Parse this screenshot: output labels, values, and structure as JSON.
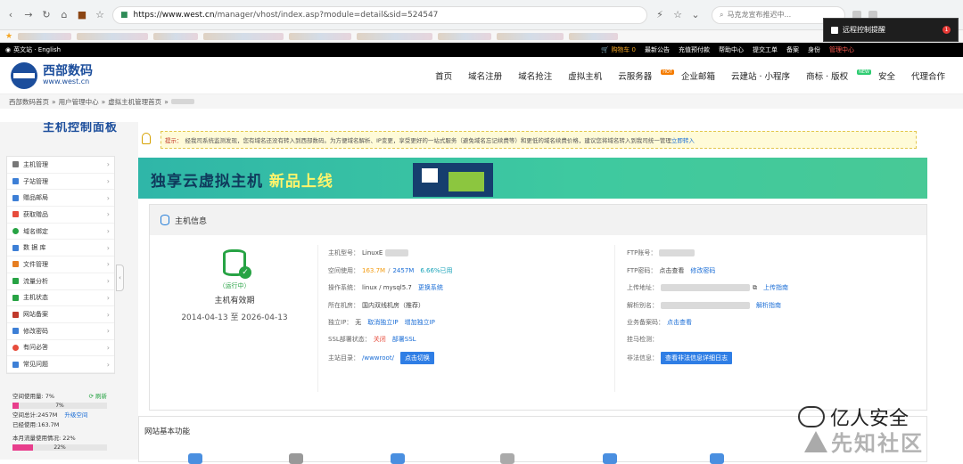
{
  "browser": {
    "url_host": "https://www.west.cn",
    "url_path": "/manager/vhost/index.asp?module=detail&sid=524547",
    "search_text": "马克龙宣布推迟中... "
  },
  "notification": {
    "title": "远程控制提醒",
    "badge": "1"
  },
  "topbar": {
    "lang": "英文站 · English",
    "cart": "购物车 0",
    "links": [
      "最新公告",
      "充值预付款",
      "帮助中心",
      "提交工单",
      "备案",
      "身份"
    ],
    "admin": "管理中心"
  },
  "header": {
    "logo_title": "西部数码",
    "logo_sub": "www.west.cn",
    "nav": [
      {
        "label": "首页"
      },
      {
        "label": "域名注册"
      },
      {
        "label": "域名抢注"
      },
      {
        "label": "虚拟主机"
      },
      {
        "label": "云服务器",
        "tag": "HOT"
      },
      {
        "label": "企业邮箱"
      },
      {
        "label": "云建站 · 小程序"
      },
      {
        "label": "商标 · 版权",
        "tag": "NEW"
      },
      {
        "label": "安全"
      },
      {
        "label": "代理合作"
      }
    ]
  },
  "breadcrumb": [
    "西部数码首页",
    "用户管理中心",
    "虚拟主机管理首页"
  ],
  "sidebar": {
    "title": "主机控制面板",
    "items": [
      {
        "label": "主机管理",
        "color": "#777"
      },
      {
        "label": "子站管理",
        "color": "#3d7fd6"
      },
      {
        "label": "赠品邮局",
        "color": "#3d7fd6"
      },
      {
        "label": "获取赠品",
        "color": "#e74c3c"
      },
      {
        "label": "域名绑定",
        "color": "#27a344"
      },
      {
        "label": "数 据 库",
        "color": "#3d7fd6"
      },
      {
        "label": "文件管理",
        "color": "#e67e22"
      },
      {
        "label": "流量分析",
        "color": "#27a344"
      },
      {
        "label": "主机状态",
        "color": "#27a344"
      },
      {
        "label": "网站备案",
        "color": "#c0392b"
      },
      {
        "label": "修改密码",
        "color": "#3d7fd6"
      },
      {
        "label": "有问必答",
        "color": "#e74c3c"
      },
      {
        "label": "常见问题",
        "color": "#3d7fd6"
      }
    ],
    "usage": {
      "space_label": "空间使用量: 7%",
      "refresh": "刷新",
      "space_pct": 7,
      "space_pct_text": "7%",
      "total": "空间总计:2457M",
      "upgrade": "升级空间",
      "used": "已经使用:163.7M",
      "flow_label": "本月流量使用情况: 22%",
      "flow_pct": 22,
      "flow_pct_text": "22%"
    }
  },
  "tip": {
    "prefix": "提示：",
    "text": "经我司系统监测发现，您有域名还没有转入到西部数码。为方便域名解析、IP变更，享受更好的一站式服务（避免域名忘记续费等）和更低的域名续费价格，建议您将域名转入到我司统一管理",
    "link": "立即转入"
  },
  "banner": {
    "title": "独享云虚拟主机",
    "new": "新品上线"
  },
  "host": {
    "heading": "主机信息",
    "status": "（运行中）",
    "valid": "主机有效期",
    "dates": "2014-04-13 至 2026-04-13",
    "model_k": "主机型号：",
    "model_v": "LinuxE",
    "space_k": "空间使用：",
    "space_used": "163.7M",
    "space_total": "2457M",
    "space_pct": "6.66%已用",
    "os_k": "操作系统：",
    "os_v": "linux / mysql5.7",
    "os_link": "更换系统",
    "room_k": "所在机房：",
    "room_v": "国内双线机房（推荐）",
    "ip_k": "独立IP：",
    "ip_v": "无",
    "ip_link1": "取消独立IP",
    "ip_link2": "增加独立IP",
    "ssl_k": "SSL部署状态：",
    "ssl_v": "关闭",
    "ssl_link": "部署SSL",
    "dir_k": "主站目录：",
    "dir_v": "/wwwroot/",
    "dir_btn": "点击切换",
    "ftp_k": "FTP账号：",
    "ftppwd_k": "FTP密码：",
    "ftppwd_v": "点击查看",
    "ftppwd_link": "修改密码",
    "upload_k": "上传地址：",
    "upload_link": "上传指南",
    "alias_k": "解析别名：",
    "alias_link": "解析指南",
    "backup_k": "业务备案码：",
    "backup_link": "点击查看",
    "hang_k": "挂马检测：",
    "illegal_k": "非法信息：",
    "illegal_btn": "查看非法信息详细日志"
  },
  "basic": {
    "title": "网站基本功能"
  },
  "watermarks": {
    "wm1": "亿人安全",
    "wm2": "先知社区"
  }
}
